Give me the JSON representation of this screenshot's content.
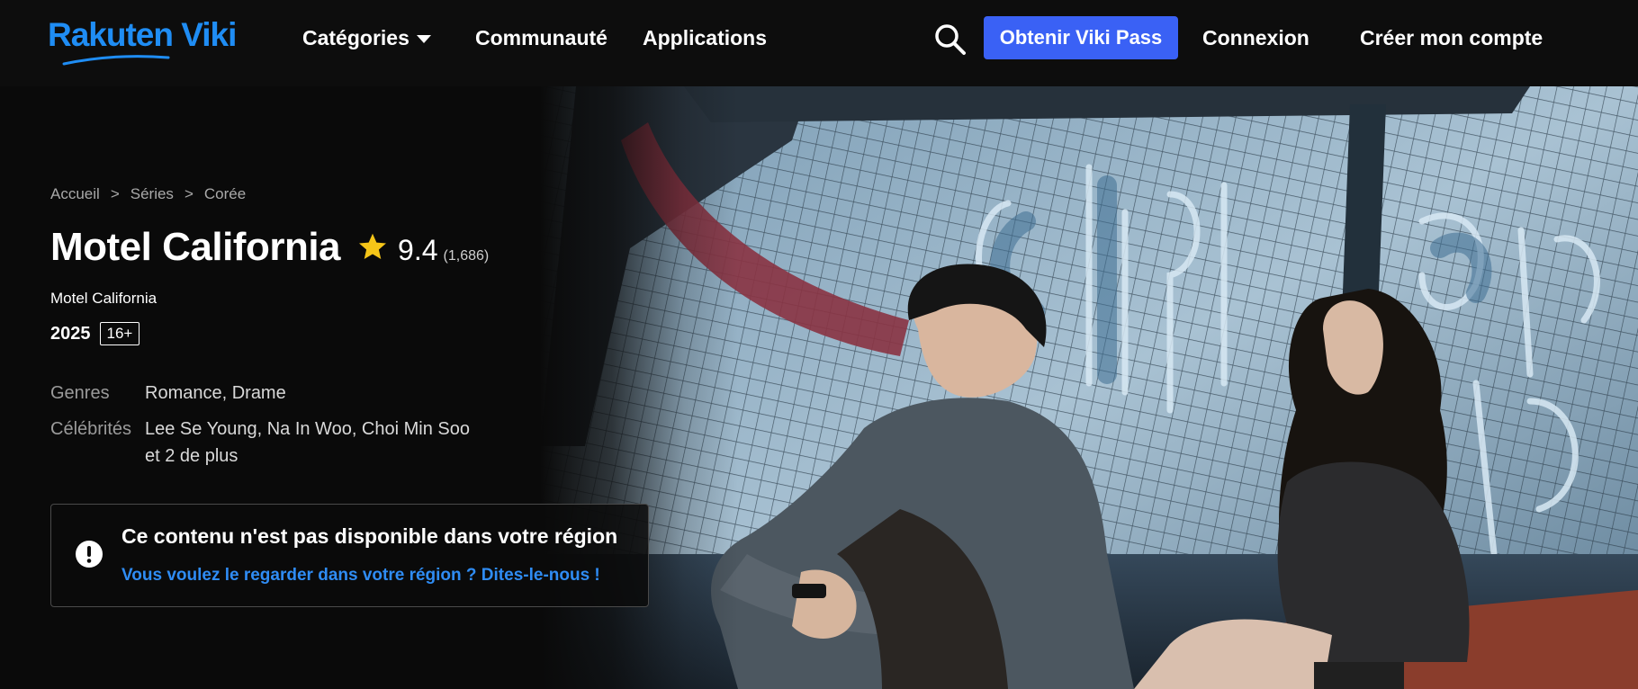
{
  "nav": {
    "logo_text": "Rakuten Viki",
    "categories_label": "Catégories",
    "community_label": "Communauté",
    "apps_label": "Applications",
    "pass_button_label": "Obtenir Viki Pass",
    "login_label": "Connexion",
    "signup_label": "Créer mon compte"
  },
  "breadcrumb": [
    "Accueil",
    ">",
    "Séries",
    ">",
    "Corée"
  ],
  "show": {
    "title": "Motel California",
    "rating": "9.4",
    "rating_count": "(1,686)",
    "subtitle": "Motel California",
    "year": "2025",
    "age_rating": "16+",
    "genres_label": "Genres",
    "genres_value": "Romance, Drame",
    "celebrities_label": "Célébrités",
    "celebrities_value": "Lee Se Young, Na In Woo, Choi Min Soo",
    "celebrities_more": "et 2 de plus"
  },
  "notice": {
    "title": "Ce contenu n'est pas disponible dans votre région",
    "link": "Vous voulez le regarder dans votre région ? Dites-le-nous !"
  },
  "colors": {
    "brand_blue": "#1f8df4",
    "pass_button": "#3a61f5",
    "link_blue": "#2f8cf4",
    "star": "#f5c518",
    "background": "#0a0a0a"
  },
  "icons": [
    "search-icon",
    "chevron-down-icon",
    "star-icon",
    "exclamation-circle-icon"
  ]
}
